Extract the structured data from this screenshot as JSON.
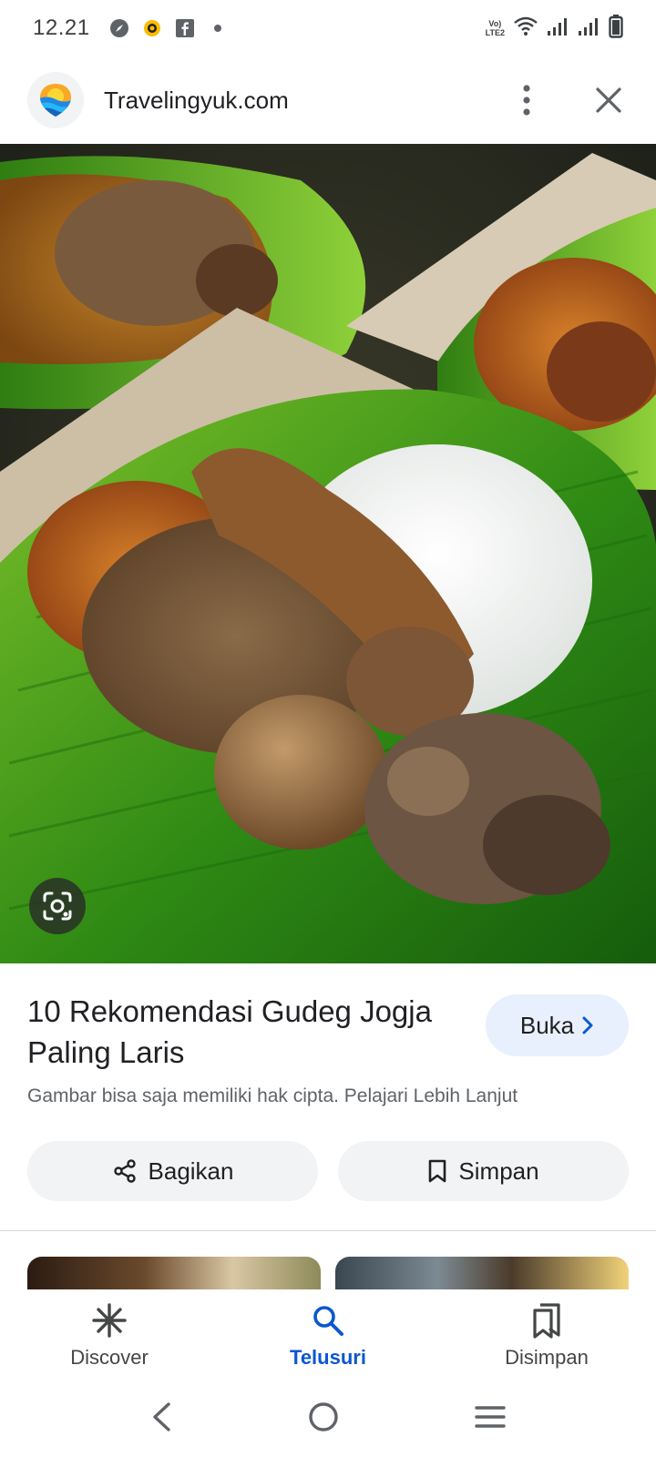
{
  "status_bar": {
    "time": "12.21",
    "network_label_1": "Vo)",
    "network_label_2": "LTE2"
  },
  "header": {
    "site_name": "Travelingyuk.com",
    "menu_icon": "more-vert-icon",
    "close_icon": "close-icon"
  },
  "image": {
    "description_icon": "lens-icon"
  },
  "result": {
    "title": "10 Rekomendasi Gudeg Jogja Paling Laris",
    "open_label": "Buka",
    "copyright_notice": "Gambar bisa saja memiliki hak cipta. Pelajari Lebih Lanjut",
    "share_label": "Bagikan",
    "save_label": "Simpan"
  },
  "bottom_nav": {
    "items": [
      {
        "label": "Discover",
        "icon": "asterisk-icon",
        "active": false
      },
      {
        "label": "Telusuri",
        "icon": "search-icon",
        "active": true
      },
      {
        "label": "Disimpan",
        "icon": "bookmarks-icon",
        "active": false
      }
    ]
  },
  "colors": {
    "accent": "#0b57d0",
    "open_button_bg": "#e8f0fe",
    "chip_bg": "#f1f3f4"
  }
}
